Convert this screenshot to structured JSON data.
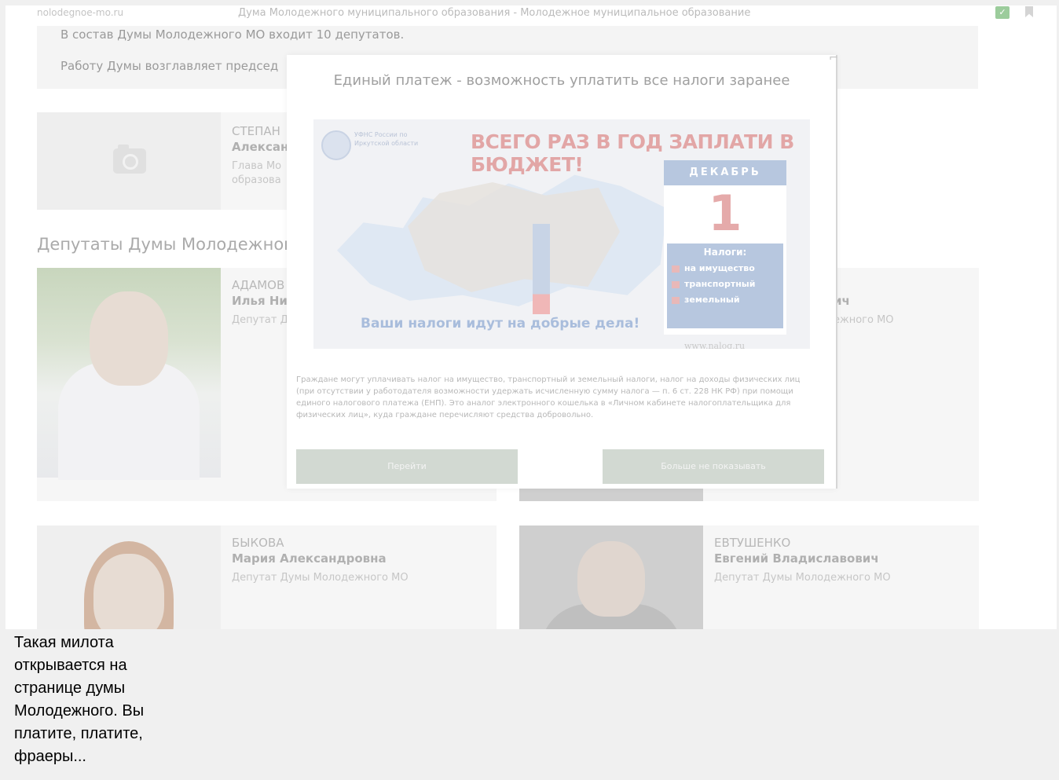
{
  "browser": {
    "domain": "nolodegnoe-mo.ru",
    "title": "Дума Молодежного муниципального образования - Молодежное муниципальное образование",
    "icons": [
      "green-square-icon",
      "bookmark-icon"
    ]
  },
  "info": {
    "line1": "В состав Думы Молодежного МО входит 10 депутатов.",
    "line2": "Работу Думы возглавляет председ"
  },
  "head": {
    "surname": "СТЕПАН",
    "name": "Алексан",
    "role": "Глава Мо образова",
    "icon": "camera-icon"
  },
  "section_title": "Депутаты Думы Молодежног",
  "deputies": [
    {
      "surname": "АДАМОВ",
      "name": "Илья Ни",
      "role": "Депутат Д"
    },
    {
      "surname": "",
      "name": "ич",
      "role": "ежного МО"
    },
    {
      "surname": "БЫКОВА",
      "name": "Мария Александровна",
      "role": "Депутат Думы Молодежного МО"
    },
    {
      "surname": "ЕВТУШЕНКО",
      "name": "Евгений Владиславович",
      "role": "Депутат Думы Молодежного МО"
    }
  ],
  "modal": {
    "close": "⌐",
    "title": "Единый платеж - возможность уплатить все налоги заранее",
    "banner": {
      "org": "УФНС России по Иркутской области",
      "headline": "ВСЕГО РАЗ В ГОД ЗАПЛАТИ В БЮДЖЕТ!",
      "month": "ДЕКАБРЬ",
      "day": "1",
      "taxes_title": "Налоги:",
      "taxes": [
        "на имущество",
        "транспортный",
        "земельный"
      ],
      "slogan": "Ваши налоги идут на добрые дела!",
      "site": "www.nalog.ru"
    },
    "text": "Граждане могут уплачивать налог на имущество, транспортный и земельный налоги, налог на доходы физических лиц (при отсутствии у работодателя возможности удержать исчисленную сумму налога — п. 6 ст. 228 НК РФ) при помощи единого налогового платежа (ЕНП). Это аналог электронного кошелька в «Личном кабинете налогоплательщика для физических лиц», куда граждане перечисляют средства добровольно.",
    "btn_go": "Перейти",
    "btn_hide": "Больше не показывать"
  },
  "caption": "Такая милота открывается на странице думы Молодежного. Вы платите, платите, фраеры..."
}
